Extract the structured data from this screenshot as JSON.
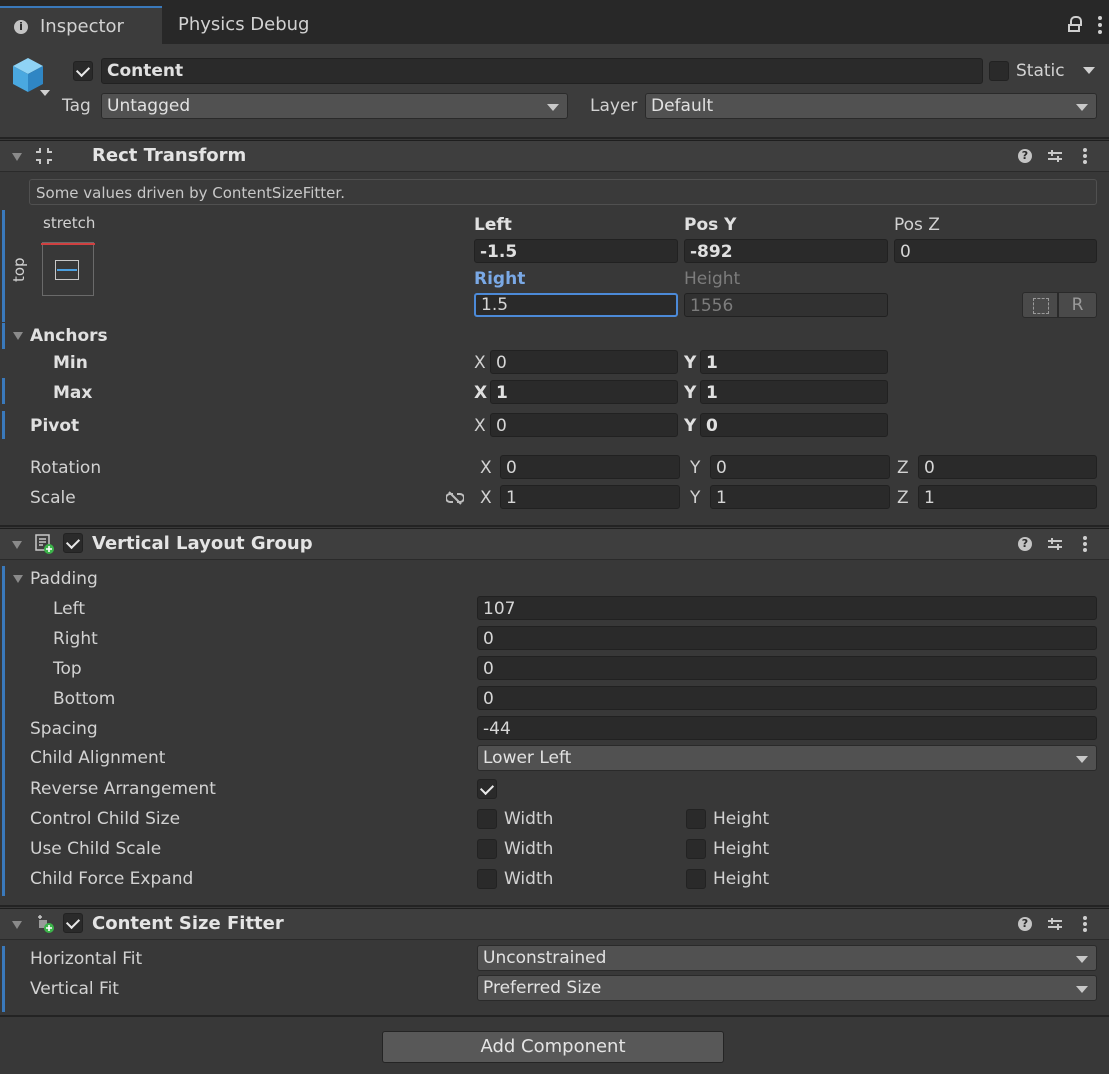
{
  "tabs": [
    {
      "label": "Inspector"
    },
    {
      "label": "Physics Debug"
    }
  ],
  "object": {
    "name": "Content",
    "active": true,
    "static_label": "Static",
    "tag_label": "Tag",
    "tag_value": "Untagged",
    "layer_label": "Layer",
    "layer_value": "Default"
  },
  "rect_transform": {
    "title": "Rect Transform",
    "info": "Some values driven by ContentSizeFitter.",
    "anchor_preset_h": "stretch",
    "anchor_preset_v": "top",
    "left_label": "Left",
    "left_value": "-1.5",
    "posy_label": "Pos Y",
    "posy_value": "-892",
    "posz_label": "Pos Z",
    "posz_value": "0",
    "right_label": "Right",
    "right_value": "1.5",
    "height_label": "Height",
    "height_value": "1556",
    "r_button": "R",
    "anchors_label": "Anchors",
    "min_label": "Min",
    "min_x": "0",
    "min_y": "1",
    "max_label": "Max",
    "max_x": "1",
    "max_y": "1",
    "pivot_label": "Pivot",
    "pivot_x": "0",
    "pivot_y": "0",
    "rotation_label": "Rotation",
    "rot_x": "0",
    "rot_y": "0",
    "rot_z": "0",
    "scale_label": "Scale",
    "scale_x": "1",
    "scale_y": "1",
    "scale_z": "1",
    "axis_x": "X",
    "axis_y": "Y",
    "axis_z": "Z"
  },
  "vlg": {
    "title": "Vertical Layout Group",
    "enabled": true,
    "padding_label": "Padding",
    "left_label": "Left",
    "left_value": "107",
    "right_label": "Right",
    "right_value": "0",
    "top_label": "Top",
    "top_value": "0",
    "bottom_label": "Bottom",
    "bottom_value": "0",
    "spacing_label": "Spacing",
    "spacing_value": "-44",
    "child_alignment_label": "Child Alignment",
    "child_alignment_value": "Lower Left",
    "reverse_label": "Reverse Arrangement",
    "control_label": "Control Child Size",
    "use_scale_label": "Use Child Scale",
    "force_expand_label": "Child Force Expand",
    "width_label": "Width",
    "height_label": "Height"
  },
  "csf": {
    "title": "Content Size Fitter",
    "enabled": true,
    "horizontal_label": "Horizontal Fit",
    "horizontal_value": "Unconstrained",
    "vertical_label": "Vertical Fit",
    "vertical_value": "Preferred Size"
  },
  "add_component": "Add Component",
  "colors": {
    "accent": "#3a79bb",
    "focus": "#4c8ad8",
    "label_blue": "#7aa9e6"
  }
}
